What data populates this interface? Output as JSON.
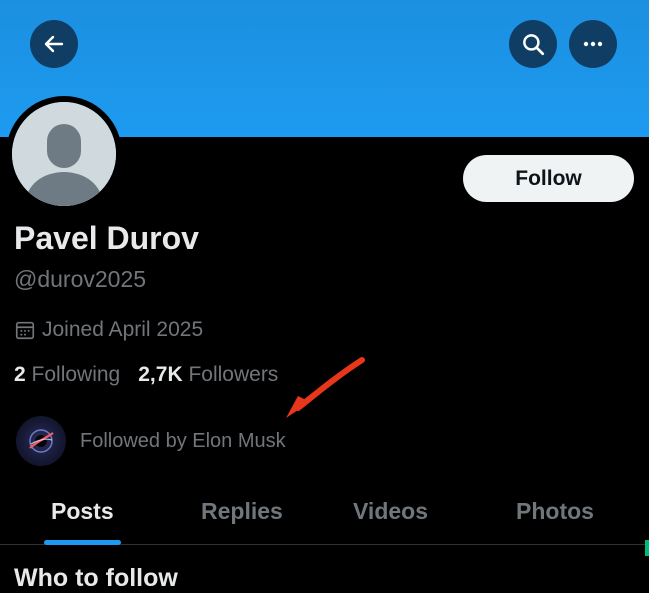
{
  "header": {
    "back_icon": "arrow-left-icon",
    "search_icon": "search-icon",
    "more_icon": "more-dots-icon",
    "banner_color": "#1d9bf0"
  },
  "profile": {
    "display_name": "Pavel Durov",
    "handle": "@durov2025",
    "joined": "Joined April 2025",
    "following_count": "2",
    "following_label": "Following",
    "followers_count": "2,7K",
    "followers_label": "Followers",
    "followed_by": "Followed by Elon Musk",
    "follow_button": "Follow"
  },
  "tabs": [
    {
      "label": "Posts",
      "active": true
    },
    {
      "label": "Replies",
      "active": false
    },
    {
      "label": "Videos",
      "active": false
    },
    {
      "label": "Photos",
      "active": false
    }
  ],
  "sections": {
    "who_to_follow": "Who to follow"
  },
  "colors": {
    "accent": "#1d9bf0",
    "annotation_arrow": "#e8361b",
    "background": "#000000"
  }
}
